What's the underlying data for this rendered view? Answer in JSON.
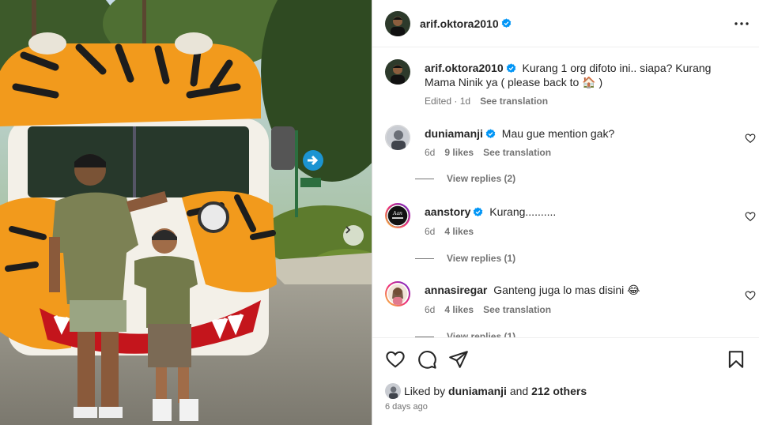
{
  "post": {
    "author": "arif.oktora2010",
    "caption_text": "Kurang 1 org difoto ini.. siapa? Kurang Mama Ninik ya ( please back to 🏠 )",
    "caption_edited": "Edited",
    "caption_age": "1d",
    "see_translation": "See translation",
    "liked_by_prefix": "Liked by",
    "liked_by_user": "duniamanji",
    "liked_by_and": "and",
    "liked_by_others": "212 others",
    "posted_time": "6 days ago"
  },
  "comments": [
    {
      "user": "duniamanji",
      "verified": true,
      "text": "Mau gue mention gak?",
      "age": "6d",
      "likes": "9 likes",
      "translate": "See translation",
      "replies": "View replies (2)"
    },
    {
      "user": "aanstory",
      "verified": true,
      "text": "Kurang..........",
      "age": "6d",
      "likes": "4 likes",
      "replies": "View replies (1)"
    },
    {
      "user": "annasiregar",
      "verified": false,
      "text": "Ganteng juga lo mas disini 😂",
      "age": "6d",
      "likes": "4 likes",
      "translate": "See translation",
      "replies": "View replies (1)"
    }
  ],
  "colors": {
    "verified_blue": "#0095f6",
    "story_ring_start": "#f9ce34",
    "story_ring_end": "#ee2a7b",
    "muted_text": "#737373"
  },
  "icons": [
    "more-options-icon",
    "heart-icon",
    "comment-icon",
    "share-icon",
    "bookmark-icon",
    "next-slide-icon",
    "verified-badge-icon"
  ]
}
